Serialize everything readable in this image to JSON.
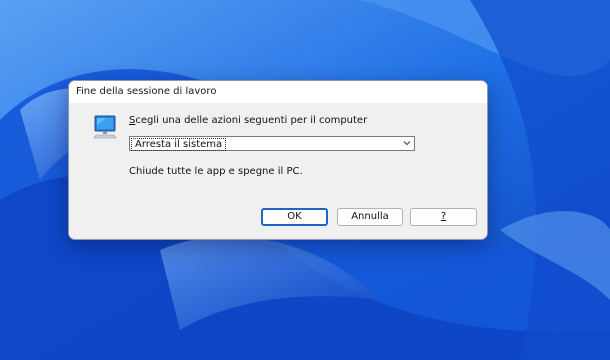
{
  "dialog": {
    "title": "Fine della sessione di lavoro",
    "icon": "computer-monitor-icon",
    "instruction_mnemonic": "S",
    "instruction_rest": "cegli una delle azioni seguenti per il computer",
    "selected_action": "Arresta il sistema",
    "description": "Chiude tutte le app e spegne il PC.",
    "buttons": {
      "ok": "OK",
      "cancel": "Annulla",
      "help": "?"
    }
  },
  "colors": {
    "wallpaper_blue": "#1f6fe6",
    "focus_border": "#1e64c8",
    "dialog_background": "#f0f0f0"
  }
}
